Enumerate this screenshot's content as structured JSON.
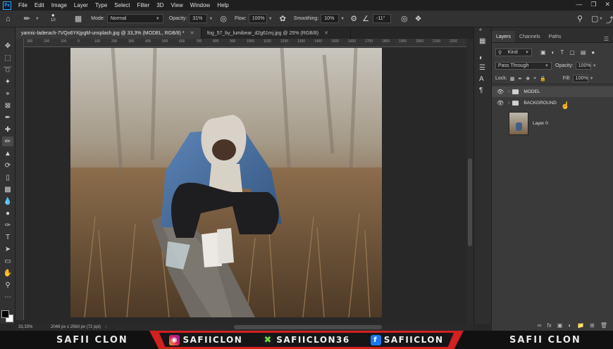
{
  "menu": [
    "File",
    "Edit",
    "Image",
    "Layer",
    "Type",
    "Select",
    "Filter",
    "3D",
    "View",
    "Window",
    "Help"
  ],
  "logo": "Ps",
  "options": {
    "brush_size": "10",
    "mode_label": "Mode:",
    "mode_value": "Normal",
    "opacity_label": "Opacity:",
    "opacity_value": "31%",
    "flow_label": "Flow:",
    "flow_value": "100%",
    "smoothing_label": "Smoothing:",
    "smoothing_value": "10%",
    "angle_value": "-11°"
  },
  "tabs": [
    {
      "label": "yannic-laderach-7VQo6YKjpgM-unsplash.jpg @ 33,3% (MODEL, RGB/8) *"
    },
    {
      "label": "fog_57_by_lumibear_d2g61mj.jpg @ 25% (RGB/8)"
    }
  ],
  "ruler_ticks": [
    "300",
    "200",
    "100",
    "0",
    "100",
    "200",
    "300",
    "400",
    "500",
    "600",
    "700",
    "800",
    "900",
    "1000",
    "1100",
    "1200",
    "1300",
    "1400",
    "1500",
    "1600",
    "1700",
    "1800",
    "1900",
    "2000",
    "2100",
    "2200",
    "2300"
  ],
  "status": {
    "zoom": "33,33%",
    "doc_size": "2048 px x 2560 px (72 ppi)"
  },
  "layers": {
    "tabs": [
      "Layers",
      "Channels",
      "Paths"
    ],
    "filter_kind": "Kind",
    "blend_mode": "Pass Through",
    "opacity_label": "Opacity:",
    "opacity_value": "100%",
    "lock_label": "Lock:",
    "fill_label": "Fill:",
    "fill_value": "100%",
    "items": [
      {
        "name": "MODEL",
        "type": "group"
      },
      {
        "name": "BACKGROUND",
        "type": "group"
      },
      {
        "name": "Layer 0",
        "type": "layer"
      }
    ]
  },
  "branding": {
    "left": "SAFII CLON",
    "right": "SAFII CLON",
    "instagram": "SAFIICLON",
    "upwork": "SAFIICLON36",
    "facebook": "SAFIICLON"
  }
}
